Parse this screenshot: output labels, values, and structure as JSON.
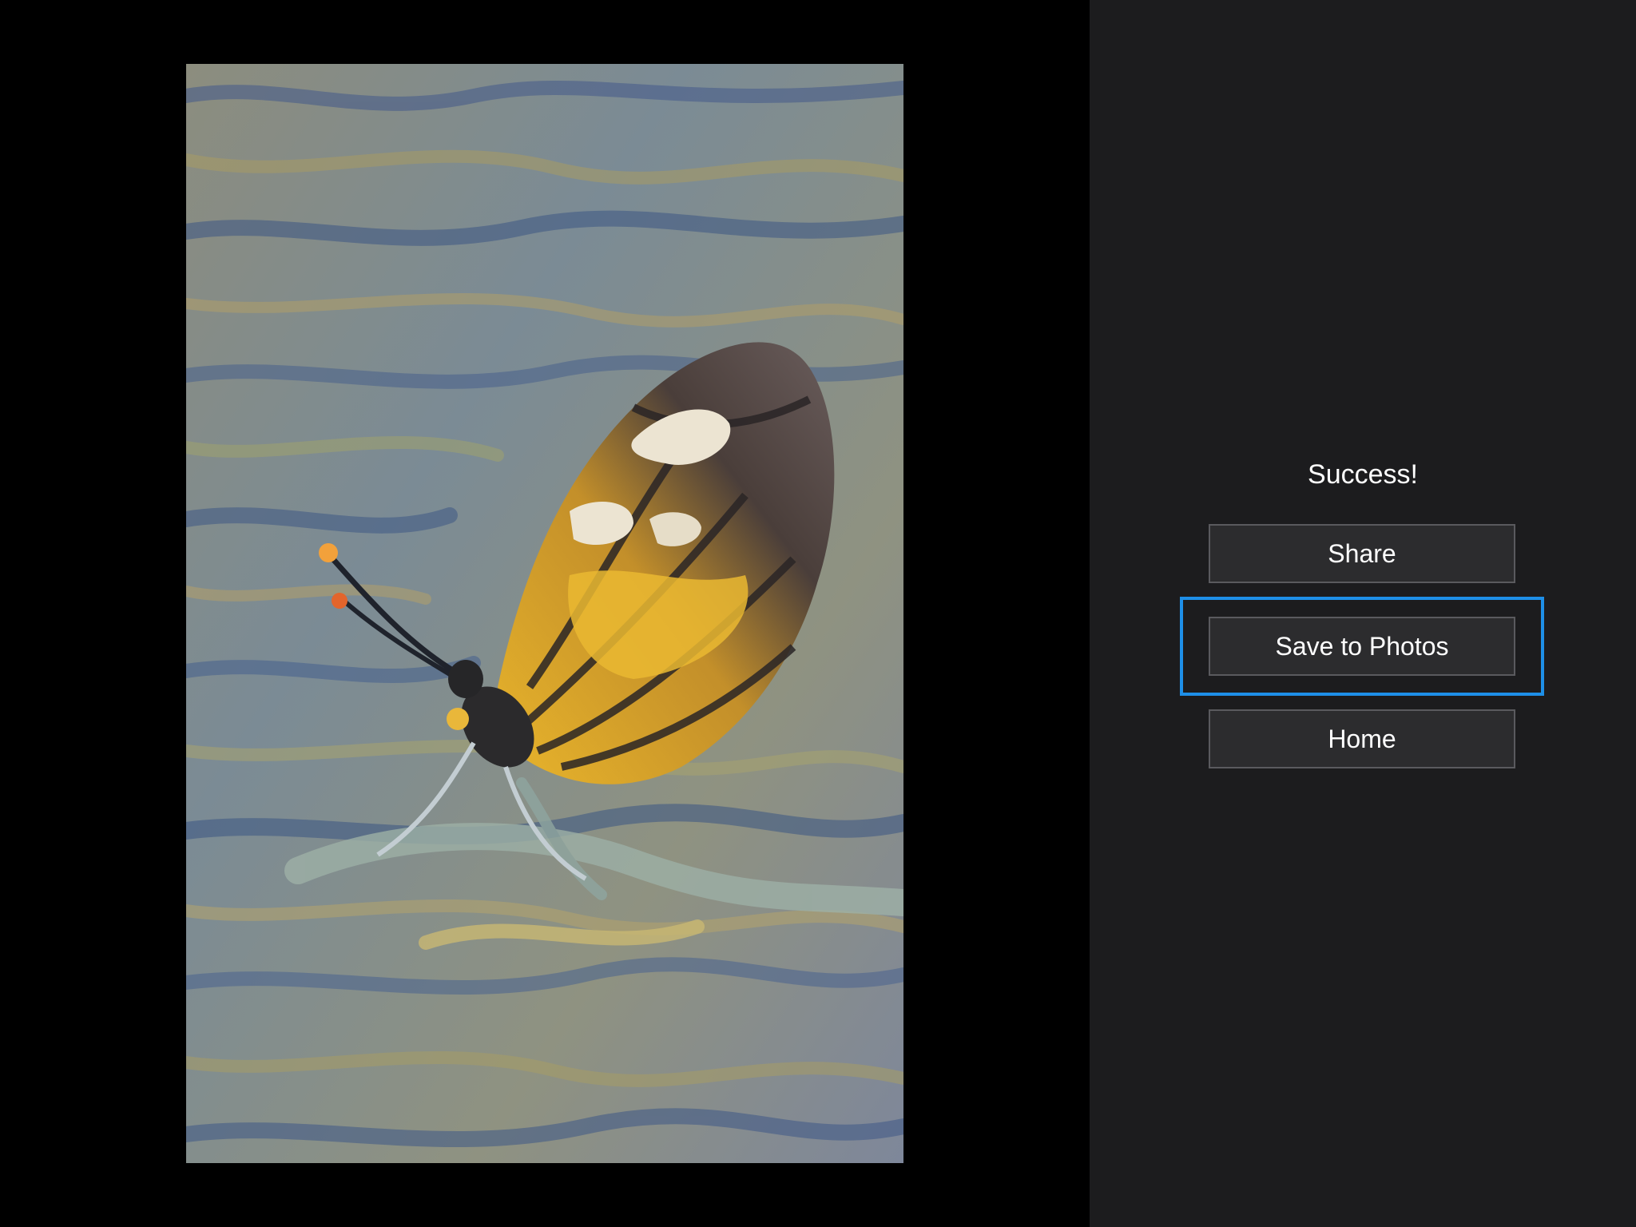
{
  "artwork": {
    "subject": "stylized-butterfly-painting",
    "palette": {
      "background": "#7f8a8e",
      "blue_strokes": "#3e5780",
      "ochre_strokes": "#a89a62",
      "wing_dark": "#3a3332",
      "wing_yellow": "#e8b52a",
      "wing_white": "#e9e2cf"
    }
  },
  "result_panel": {
    "status_text": "Success!",
    "buttons": {
      "share_label": "Share",
      "save_label": "Save to Photos",
      "home_label": "Home"
    },
    "focused_button": "save_to_photos"
  },
  "colors": {
    "panel_bg": "#1c1c1e",
    "button_bg": "#2c2c2e",
    "button_border": "#5a5a5e",
    "focus_ring": "#1e8fe8",
    "text": "#ffffff"
  }
}
